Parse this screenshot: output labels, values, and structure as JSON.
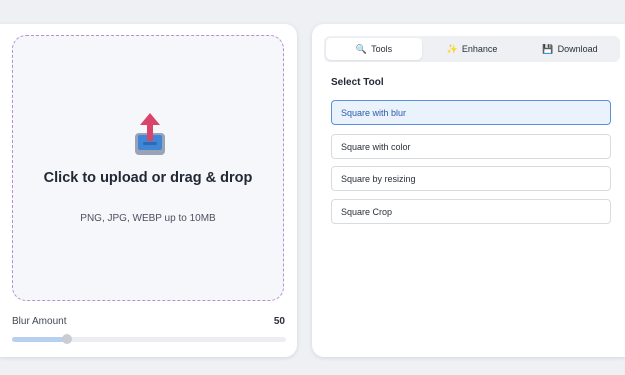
{
  "upload": {
    "title": "Click to upload or drag & drop",
    "subtitle": "PNG, JPG, WEBP up to 10MB",
    "icon": "upload-tray-icon"
  },
  "blur": {
    "label": "Blur Amount",
    "value": "50",
    "fraction": 0.2
  },
  "tabs": [
    {
      "label": "Tools",
      "icon": "🔍",
      "icon_name": "magnifier-icon",
      "active": true
    },
    {
      "label": "Enhance",
      "icon": "✨",
      "icon_name": "sparkles-icon",
      "active": false
    },
    {
      "label": "Download",
      "icon": "💾",
      "icon_name": "floppy-disk-icon",
      "active": false
    }
  ],
  "tools": {
    "heading": "Select Tool",
    "options": [
      {
        "label": "Square with blur",
        "selected": true
      },
      {
        "label": "Square with color",
        "selected": false
      },
      {
        "label": "Square by resizing",
        "selected": false
      },
      {
        "label": "Square Crop",
        "selected": false
      }
    ]
  },
  "colors": {
    "accent": "#5d8fe0",
    "dropzone_border": "#b98ed8",
    "slider_fill": "#b8d0ef"
  }
}
